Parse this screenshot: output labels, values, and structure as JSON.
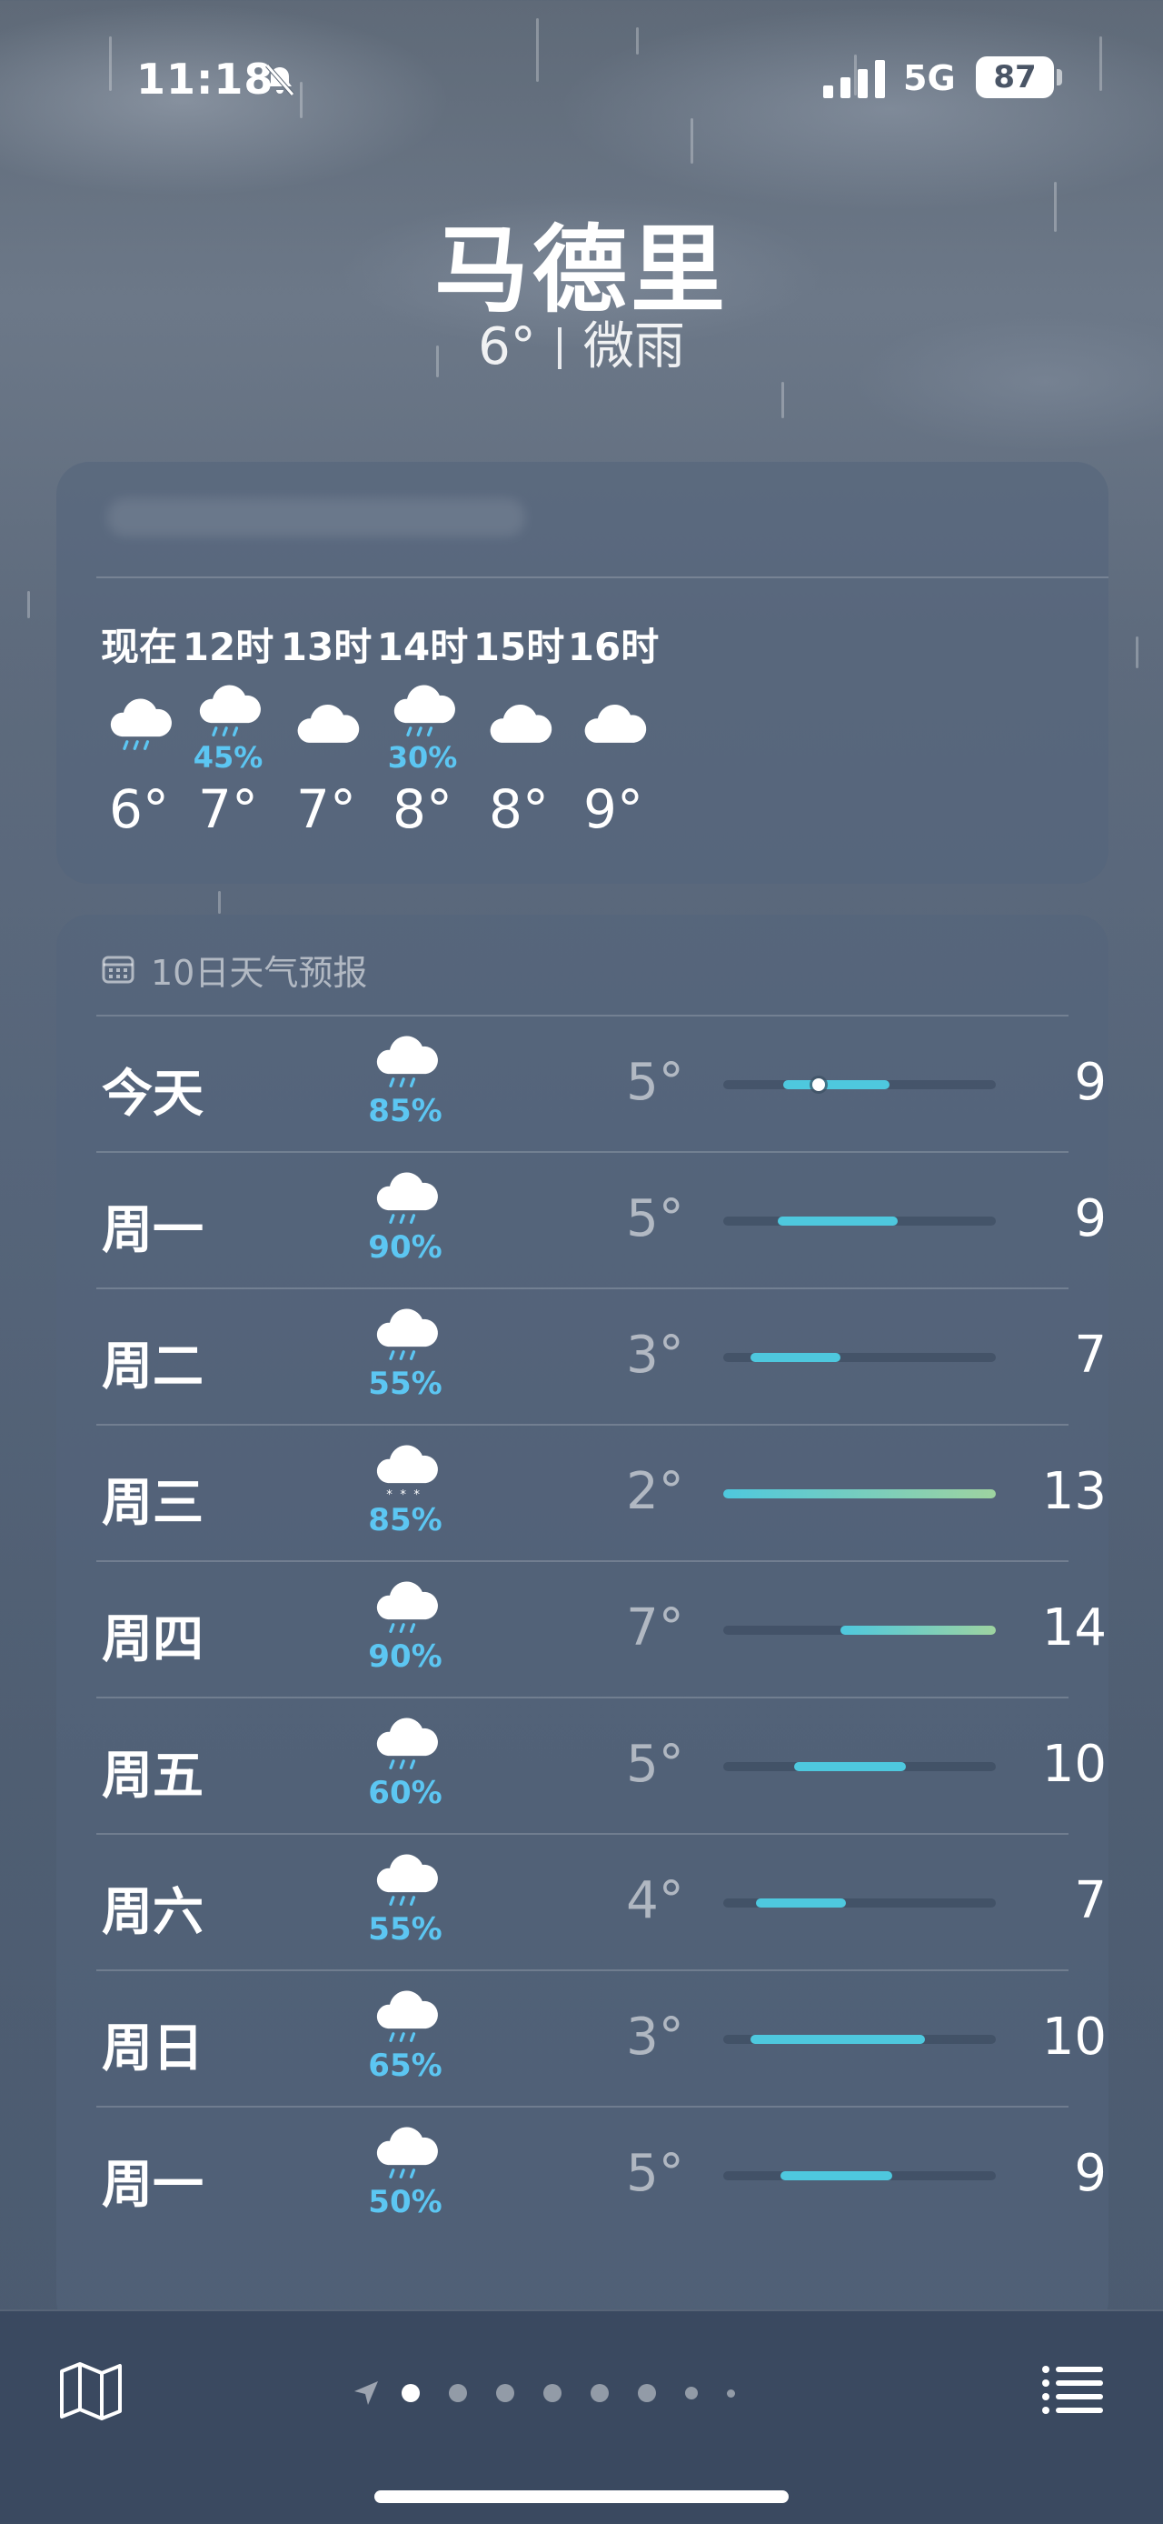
{
  "status_bar": {
    "time": "11:18",
    "network": "5G",
    "battery": "87"
  },
  "header": {
    "city": "马德里",
    "temperature": "6°",
    "condition": "微雨"
  },
  "hourly": [
    {
      "time": "现在",
      "icon": "rain-cloud-icon",
      "precip": "",
      "temp": "6°"
    },
    {
      "time": "12时",
      "icon": "rain-cloud-icon",
      "precip": "45%",
      "temp": "7°"
    },
    {
      "time": "13时",
      "icon": "cloud-icon",
      "precip": "",
      "temp": "7°"
    },
    {
      "time": "14时",
      "icon": "rain-cloud-icon",
      "precip": "30%",
      "temp": "8°"
    },
    {
      "time": "15时",
      "icon": "cloud-icon",
      "precip": "",
      "temp": "8°"
    },
    {
      "time": "16时",
      "icon": "cloud-icon",
      "precip": "",
      "temp": "9°"
    }
  ],
  "forecast": {
    "title": "10日天气预报",
    "days": [
      {
        "day": "今天",
        "icon": "rain-cloud-icon",
        "precip": "85%",
        "low": "5°",
        "high": "9°",
        "range_start": 0.22,
        "range_end": 0.61,
        "current": 0.35
      },
      {
        "day": "周一",
        "icon": "rain-cloud-icon",
        "precip": "90%",
        "low": "5°",
        "high": "9°",
        "range_start": 0.2,
        "range_end": 0.64
      },
      {
        "day": "周二",
        "icon": "rain-cloud-icon",
        "precip": "55%",
        "low": "3°",
        "high": "7°",
        "range_start": 0.1,
        "range_end": 0.43
      },
      {
        "day": "周三",
        "icon": "snow-rain-cloud-icon",
        "precip": "85%",
        "low": "2°",
        "high": "13°",
        "range_start": 0.0,
        "range_end": 1.0
      },
      {
        "day": "周四",
        "icon": "rain-cloud-icon",
        "precip": "90%",
        "low": "7°",
        "high": "14°",
        "range_start": 0.43,
        "range_end": 1.0
      },
      {
        "day": "周五",
        "icon": "rain-cloud-icon",
        "precip": "60%",
        "low": "5°",
        "high": "10°",
        "range_start": 0.26,
        "range_end": 0.67
      },
      {
        "day": "周六",
        "icon": "rain-cloud-icon",
        "precip": "55%",
        "low": "4°",
        "high": "7°",
        "range_start": 0.12,
        "range_end": 0.45
      },
      {
        "day": "周日",
        "icon": "rain-cloud-icon",
        "precip": "65%",
        "low": "3°",
        "high": "10°",
        "range_start": 0.1,
        "range_end": 0.74
      },
      {
        "day": "周一",
        "icon": "rain-cloud-icon",
        "precip": "50%",
        "low": "5°",
        "high": "9°",
        "range_start": 0.21,
        "range_end": 0.62
      }
    ]
  },
  "colors": {
    "precip": "#5cc6f2",
    "bar": "#4ec8de",
    "bar_warm": "#9ed3a0"
  },
  "pager": {
    "pages": 9,
    "active_index": 0
  }
}
